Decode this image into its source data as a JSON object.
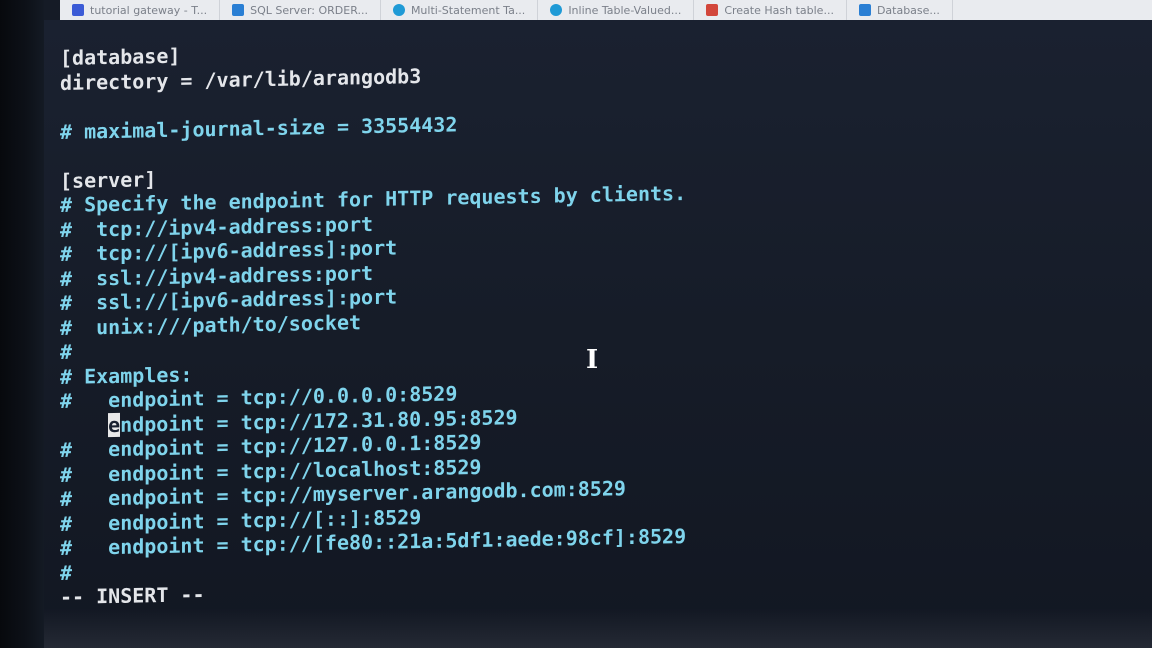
{
  "browser_tabs": [
    {
      "label": "tutorial gateway - T...",
      "icon": "tutorialgateway-icon",
      "color": "#3b5bd6"
    },
    {
      "label": "SQL Server: ORDER...",
      "icon": "sqlserver-icon",
      "color": "#2a7fd4"
    },
    {
      "label": "Multi-Statement Ta...",
      "icon": "msdocs-icon",
      "color": "#1f9ad6"
    },
    {
      "label": "Inline Table-Valued...",
      "icon": "page-icon",
      "color": "#1f9ad6"
    },
    {
      "label": "Create Hash table...",
      "icon": "page-icon",
      "color": "#d2463b"
    },
    {
      "label": "Database...",
      "icon": "page-icon",
      "color": "#2a7fd4"
    }
  ],
  "editor": {
    "lines": [
      {
        "text": "[database]",
        "style": "plain"
      },
      {
        "text": "directory = /var/lib/arangodb3",
        "style": "plain"
      },
      {
        "text": "",
        "style": "plain"
      },
      {
        "text": "# maximal-journal-size = 33554432",
        "style": "cmt"
      },
      {
        "text": "",
        "style": "plain"
      },
      {
        "text": "[server]",
        "style": "plain"
      },
      {
        "text": "# Specify the endpoint for HTTP requests by clients.",
        "style": "cmt"
      },
      {
        "text": "#  tcp://ipv4-address:port",
        "style": "cmt"
      },
      {
        "text": "#  tcp://[ipv6-address]:port",
        "style": "cmt"
      },
      {
        "text": "#  ssl://ipv4-address:port",
        "style": "cmt"
      },
      {
        "text": "#  ssl://[ipv6-address]:port",
        "style": "cmt"
      },
      {
        "text": "#  unix:///path/to/socket",
        "style": "cmt"
      },
      {
        "text": "#",
        "style": "cmt"
      },
      {
        "text": "# Examples:",
        "style": "cmt"
      },
      {
        "text": "#   endpoint = tcp://0.0.0.0:8529",
        "style": "cmt"
      },
      {
        "text": "endpoint = tcp://172.31.80.95:8529",
        "style": "cursor"
      },
      {
        "text": "#   endpoint = tcp://127.0.0.1:8529",
        "style": "cmt"
      },
      {
        "text": "#   endpoint = tcp://localhost:8529",
        "style": "cmt"
      },
      {
        "text": "#   endpoint = tcp://myserver.arangodb.com:8529",
        "style": "cmt"
      },
      {
        "text": "#   endpoint = tcp://[::]:8529",
        "style": "cmt"
      },
      {
        "text": "#   endpoint = tcp://[fe80::21a:5df1:aede:98cf]:8529",
        "style": "cmt"
      },
      {
        "text": "#",
        "style": "cmt"
      }
    ],
    "cursor_line": {
      "prefix": "    ",
      "cursor_char": "e",
      "rest": "ndpoint = tcp://172.31.80.95:8529"
    },
    "status_mode": "-- INSERT --"
  },
  "mouse_cursor": "I",
  "colors": {
    "comment": "#7fd4ec",
    "text": "#e4e6ea",
    "background": "#161c28"
  }
}
